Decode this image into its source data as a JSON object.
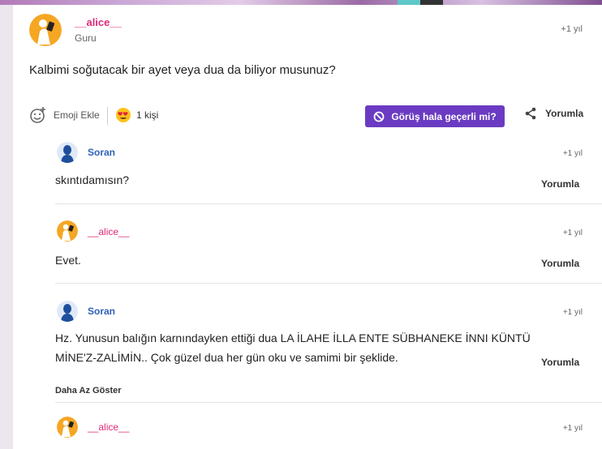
{
  "post": {
    "username": "__alice__",
    "rank": "Guru",
    "time": "+1 yıl",
    "text": "Kalbimi soğutacak bir ayet veya dua da biliyor musunuz?"
  },
  "actions": {
    "emoji_label": "Emoji Ekle",
    "reaction_count": "1 kişi",
    "view_button": "Görüş hala geçerli mi?",
    "comment_label": "Yorumla"
  },
  "comments": [
    {
      "username": "Soran",
      "time": "+1 yıl",
      "text": "skıntıdamısın?",
      "reply": "Yorumla"
    },
    {
      "username": "__alice__",
      "time": "+1 yıl",
      "text": "Evet.",
      "reply": "Yorumla"
    },
    {
      "username": "Soran",
      "time": "+1 yıl",
      "text_line1": "Hz. Yunusun balığın karnındayken ettiği dua LA İLAHE İLLA ENTE SÜBHANEKE İNNI KÜNTÜ",
      "text_line2": "MİNE'Z-ZALİMİN.. Çok güzel dua her gün oku ve samimi bir şeklide.",
      "reply": "Yorumla"
    },
    {
      "username": "__alice__",
      "time": "+1 yıl"
    }
  ],
  "show_less": "Daha Az Göster",
  "colors": {
    "accent_purple": "#6a3bc2",
    "username_pink": "#e0287a",
    "username_blue": "#2f62b8",
    "avatar_orange": "#f5a623"
  }
}
